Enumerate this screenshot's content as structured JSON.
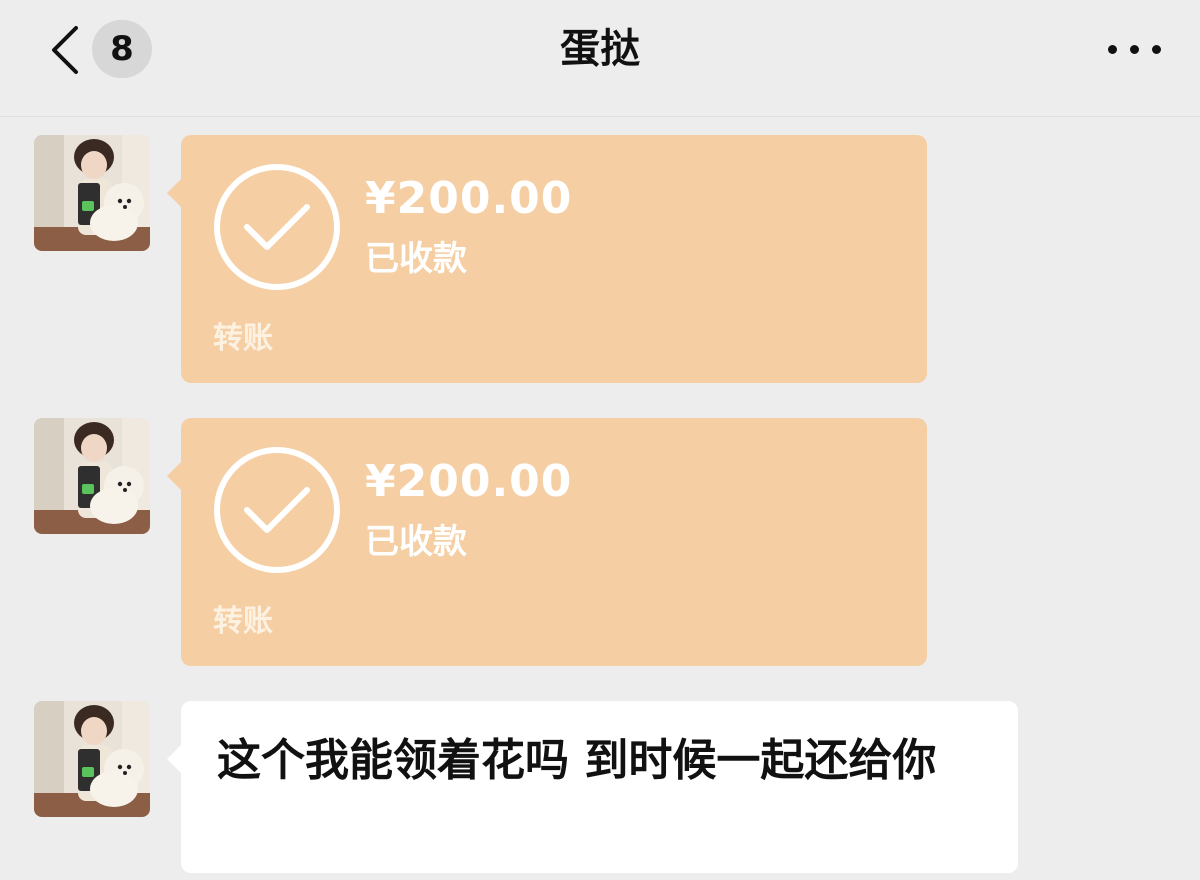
{
  "nav": {
    "unread_count": "8",
    "title": "蛋挞",
    "back_icon": "chevron-left-icon",
    "more_icon": "more-horizontal-icon"
  },
  "colors": {
    "background": "#ededed",
    "transfer_card": "#f5cfa3",
    "bubble": "#ffffff",
    "text": "#111111"
  },
  "messages": [
    {
      "type": "transfer",
      "amount": "¥200.00",
      "status": "已收款",
      "label": "转账",
      "icon": "check-circle-icon"
    },
    {
      "type": "transfer",
      "amount": "¥200.00",
      "status": "已收款",
      "label": "转账",
      "icon": "check-circle-icon"
    },
    {
      "type": "text",
      "text": "这个我能领着花吗 到时候一起还给你"
    }
  ]
}
